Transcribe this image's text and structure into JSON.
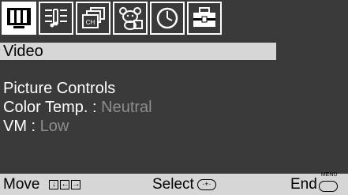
{
  "tabs": [
    {
      "icon": "video-icon",
      "active": true
    },
    {
      "icon": "audio-icon",
      "active": false
    },
    {
      "icon": "channel-icon",
      "active": false
    },
    {
      "icon": "parental-icon",
      "active": false
    },
    {
      "icon": "timer-icon",
      "active": false
    },
    {
      "icon": "setup-icon",
      "active": false
    }
  ],
  "menu": {
    "title": "Video",
    "picture_controls": "Picture Controls",
    "color_temp_label": "Color Temp. : ",
    "color_temp_value": "Neutral",
    "vm_label": "VM : ",
    "vm_value": "Low"
  },
  "bottom": {
    "move_label": "Move",
    "select_label": "Select",
    "end_label": "End",
    "menu_key_label": "MENU",
    "channel_glyph": "CH"
  },
  "colors": {
    "background": "#3a3a3a",
    "bar": "#d6d6d6",
    "text": "#ffffff",
    "value": "#8e8e8e"
  }
}
